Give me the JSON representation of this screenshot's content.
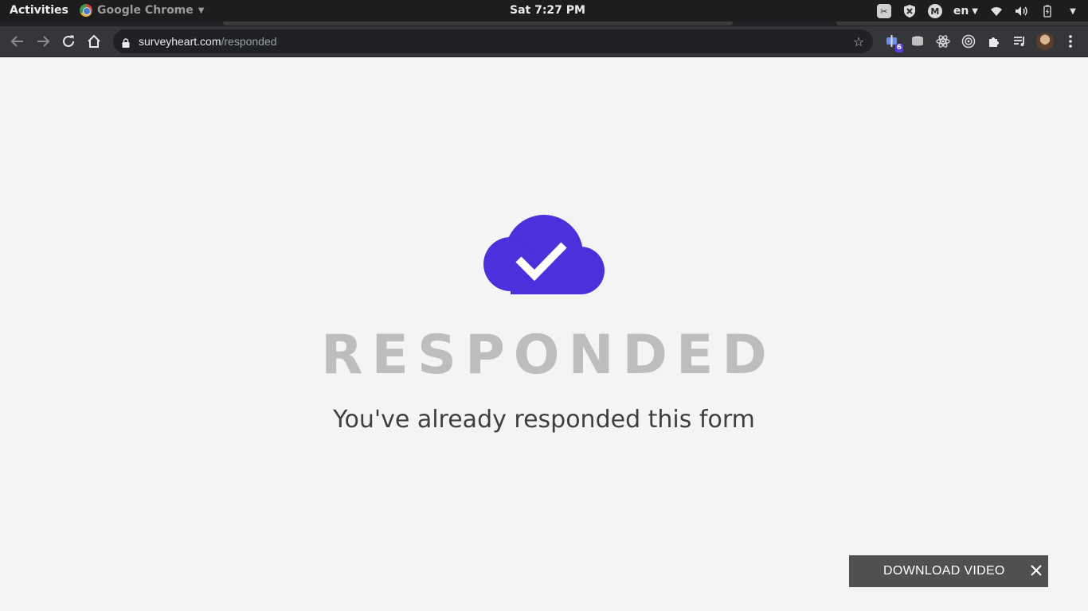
{
  "system": {
    "activities_label": "Activities",
    "app_name": "Google Chrome",
    "clock": "Sat  7:27 PM",
    "language": "en"
  },
  "browser": {
    "url_host": "surveyheart.com",
    "url_path": "/responded",
    "extension_badge": "6"
  },
  "page": {
    "title": "RESPONDED",
    "subtitle": "You've already responded this form",
    "accent_color": "#4b30dc"
  },
  "download_bar": {
    "label": "DOWNLOAD VIDEO"
  }
}
